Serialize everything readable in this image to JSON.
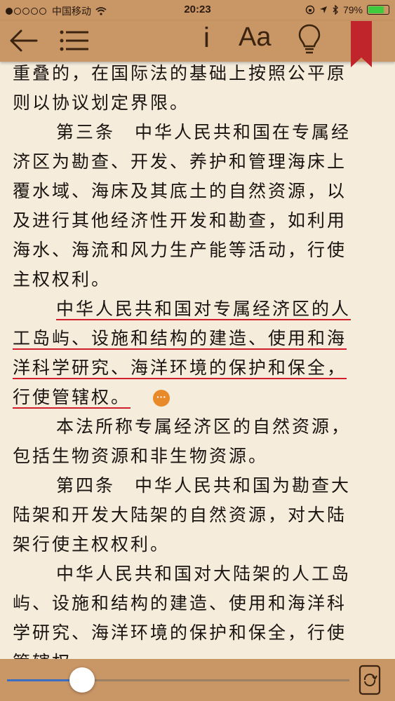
{
  "status_bar": {
    "carrier": "中国移动",
    "time": "20:23",
    "battery_percent": "79%",
    "battery_level": 0.79,
    "signal_bars": 1
  },
  "toolbar": {
    "back_icon": "arrow-left-icon",
    "toc_icon": "list-icon",
    "info_label": "i",
    "font_label": "Aa",
    "brightness_icon": "lightbulb-icon",
    "bookmark_icon": "bookmark-icon"
  },
  "content": {
    "lines": [
      {
        "text": "重叠的，在国际法的基础上按照公平原",
        "indent": false,
        "highlight": false
      },
      {
        "text": "则以协议划定界限。",
        "indent": false,
        "highlight": false
      },
      {
        "text": "第三条　中华人民共和国在专属经",
        "indent": true,
        "highlight": false
      },
      {
        "text": "济区为勘查、开发、养护和管理海床上",
        "indent": false,
        "highlight": false
      },
      {
        "text": "覆水域、海床及其底土的自然资源，以",
        "indent": false,
        "highlight": false
      },
      {
        "text": "及进行其他经济性开发和勘查，如利用",
        "indent": false,
        "highlight": false
      },
      {
        "text": "海水、海流和风力生产能等活动，行使",
        "indent": false,
        "highlight": false
      },
      {
        "text": "主权权利。",
        "indent": false,
        "highlight": false
      },
      {
        "text": "中华人民共和国对专属经济区的人",
        "indent": true,
        "highlight": true
      },
      {
        "text": "工岛屿、设施和结构的建造、使用和海",
        "indent": false,
        "highlight": true
      },
      {
        "text": "洋科学研究、海洋环境的保护和保全，",
        "indent": false,
        "highlight": true
      },
      {
        "text": "行使管辖权。",
        "indent": false,
        "highlight": true
      },
      {
        "text": "本法所称专属经济区的自然资源，",
        "indent": true,
        "highlight": false
      },
      {
        "text": "包括生物资源和非生物资源。",
        "indent": false,
        "highlight": false
      },
      {
        "text": "第四条　中华人民共和国为勘查大",
        "indent": true,
        "highlight": false
      },
      {
        "text": "陆架和开发大陆架的自然资源，对大陆",
        "indent": false,
        "highlight": false
      },
      {
        "text": "架行使主权权利。",
        "indent": false,
        "highlight": false
      },
      {
        "text": "中华人民共和国对大陆架的人工岛",
        "indent": true,
        "highlight": false
      },
      {
        "text": "屿、设施和结构的建造、使用和海洋科",
        "indent": false,
        "highlight": false
      },
      {
        "text": "学研究、海洋环境的保护和保全，行使",
        "indent": false,
        "highlight": false
      },
      {
        "text": "管辖权。",
        "indent": false,
        "highlight": false
      }
    ],
    "note_label": "···"
  },
  "bottom_bar": {
    "progress": 0.22,
    "rotate_icon": "rotate-lock-icon"
  },
  "colors": {
    "bar": "#c99666",
    "page": "#f5ecdc",
    "highlight_underline": "#d01f2a",
    "bookmark": "#c0252b",
    "slider_fill": "#3c6ec4"
  }
}
